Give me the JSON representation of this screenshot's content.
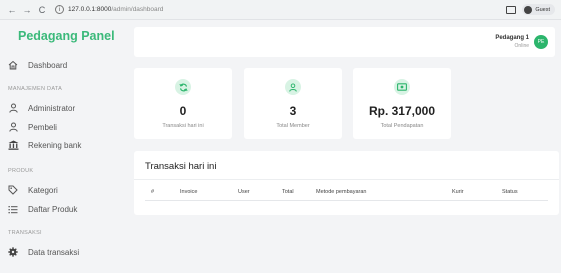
{
  "browser": {
    "nav_back": "←",
    "nav_forward": "→",
    "nav_reload": "C",
    "url_host": "127.0.0.1:8000",
    "url_path": "/admin/dashboard",
    "profile_label": "Guest"
  },
  "sidebar": {
    "brand": "Pedagang Panel",
    "dashboard": "Dashboard",
    "sections": [
      {
        "title": "MANAJEMEN DATA",
        "items": [
          {
            "label": "Administrator",
            "icon": "user-icon"
          },
          {
            "label": "Pembeli",
            "icon": "user-icon"
          },
          {
            "label": "Rekening bank",
            "icon": "bank-icon"
          }
        ]
      },
      {
        "title": "PRODUK",
        "items": [
          {
            "label": "Kategori",
            "icon": "tag-icon"
          },
          {
            "label": "Daftar Produk",
            "icon": "list-icon"
          }
        ]
      },
      {
        "title": "TRANSAKSI",
        "items": [
          {
            "label": "Data transaksi",
            "icon": "gear-icon"
          }
        ]
      }
    ]
  },
  "topbar": {
    "user_name": "Pedagang 1",
    "user_status": "Online",
    "avatar_initials": "PE"
  },
  "stats": [
    {
      "value": "0",
      "label": "Transaksi hari ini",
      "icon": "refresh-icon"
    },
    {
      "value": "3",
      "label": "Total Member",
      "icon": "user-icon"
    },
    {
      "value": "Rp. 317,000",
      "label": "Total Pendapatan",
      "icon": "money-icon"
    }
  ],
  "transactions": {
    "title": "Transaksi hari ini",
    "columns": [
      "#",
      "Invoice",
      "User",
      "Total",
      "Metode pembayaran",
      "Kurir",
      "Status"
    ]
  },
  "colors": {
    "brand": "#3bb97a",
    "badge_bg": "#d8f3e4",
    "badge_icon": "#2cb56c",
    "avatar": "#2cb56c"
  }
}
